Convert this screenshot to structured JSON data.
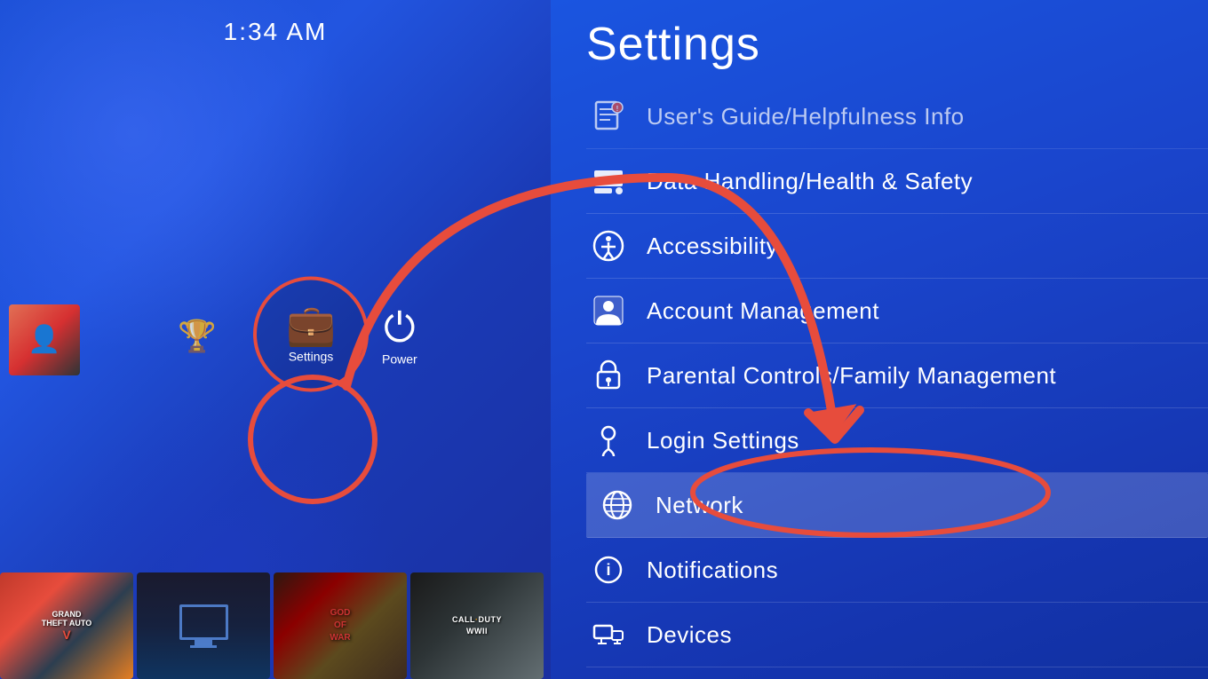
{
  "time": "1:34 AM",
  "left": {
    "settings_label": "Settings",
    "power_label": "Power",
    "games": [
      {
        "name": "Grand Theft Auto V",
        "short": "GRAND\nTHEFT AUTO V"
      },
      {
        "name": "Monitor/TV"
      },
      {
        "name": "God of War",
        "short": "GOD\nOF\nWAR"
      },
      {
        "name": "Call of Duty WWII",
        "short": "CALL·DUTY\nWWII"
      }
    ]
  },
  "right": {
    "title": "Settings",
    "menu_items": [
      {
        "id": "users-guide",
        "label": "User's Guide/Helpfulness Info",
        "icon": "🛡️"
      },
      {
        "id": "data-handling",
        "label": "Data Handling/Health & Safety",
        "icon": "📊"
      },
      {
        "id": "accessibility",
        "label": "Accessibility",
        "icon": "♿"
      },
      {
        "id": "account-management",
        "label": "Account Management",
        "icon": "👤"
      },
      {
        "id": "parental-controls",
        "label": "Parental Controls/Family Management",
        "icon": "🔒"
      },
      {
        "id": "login-settings",
        "label": "Login Settings",
        "icon": "🔑"
      },
      {
        "id": "network",
        "label": "Network",
        "icon": "🌐"
      },
      {
        "id": "notifications",
        "label": "Notifications",
        "icon": "ℹ️"
      },
      {
        "id": "devices",
        "label": "Devices",
        "icon": "🖥️"
      }
    ]
  }
}
